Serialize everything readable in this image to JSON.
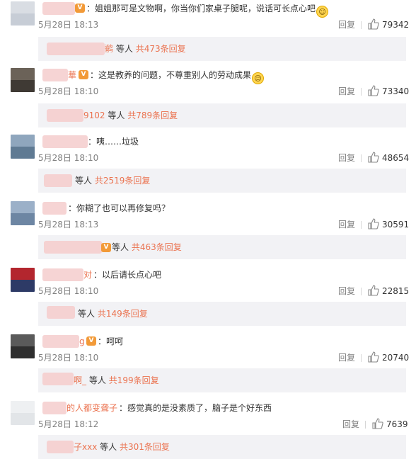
{
  "ui": {
    "reply_label": "回复",
    "people_label": "等人"
  },
  "comments": [
    {
      "name_frag": "",
      "text": "姐姐那可是文物啊，你当你们家桌子腿呢，说话可长点心吧",
      "emoji": "😊",
      "time": "5月28日 18:13",
      "likes": "79342",
      "sub": {
        "frag": "鹡",
        "total": "共473条回复"
      }
    },
    {
      "name_frag": "華",
      "text": "这是教养的问题，不尊重别人的劳动成果",
      "emoji": "😏",
      "time": "5月28日 18:10",
      "likes": "73340",
      "sub": {
        "frag": "9102",
        "total": "共789条回复"
      }
    },
    {
      "name_frag": "",
      "text": "咦……垃圾",
      "emoji": "",
      "time": "5月28日 18:10",
      "likes": "48654",
      "sub": {
        "frag": "",
        "total": "共2519条回复"
      }
    },
    {
      "name_frag": "",
      "text": "你糊了也可以再修复吗？",
      "emoji": "",
      "time": "5月28日 18:13",
      "likes": "30591",
      "sub": {
        "frag": "",
        "total": "共463条回复"
      }
    },
    {
      "name_frag": "对",
      "text": "以后请长点心吧",
      "emoji": "",
      "time": "5月28日 18:10",
      "likes": "22815",
      "sub": {
        "frag": "",
        "total": "共149条回复"
      }
    },
    {
      "name_frag": "g",
      "text": "呵呵",
      "emoji": "",
      "time": "5月28日 18:10",
      "likes": "20740",
      "sub": {
        "frag": "啊_",
        "total": "共199条回复"
      }
    },
    {
      "name_frag": "的人都变聋子",
      "text": "感觉真的是没素质了，脑子是个好东西",
      "emoji": "",
      "time": "5月28日 18:12",
      "likes": "7639",
      "sub": {
        "frag": "子xxx",
        "total": "共301条回复"
      }
    }
  ],
  "colors": {
    "accent": "#eb7350",
    "muted": "#808080",
    "subbox_bg": "#f2f2f5"
  }
}
